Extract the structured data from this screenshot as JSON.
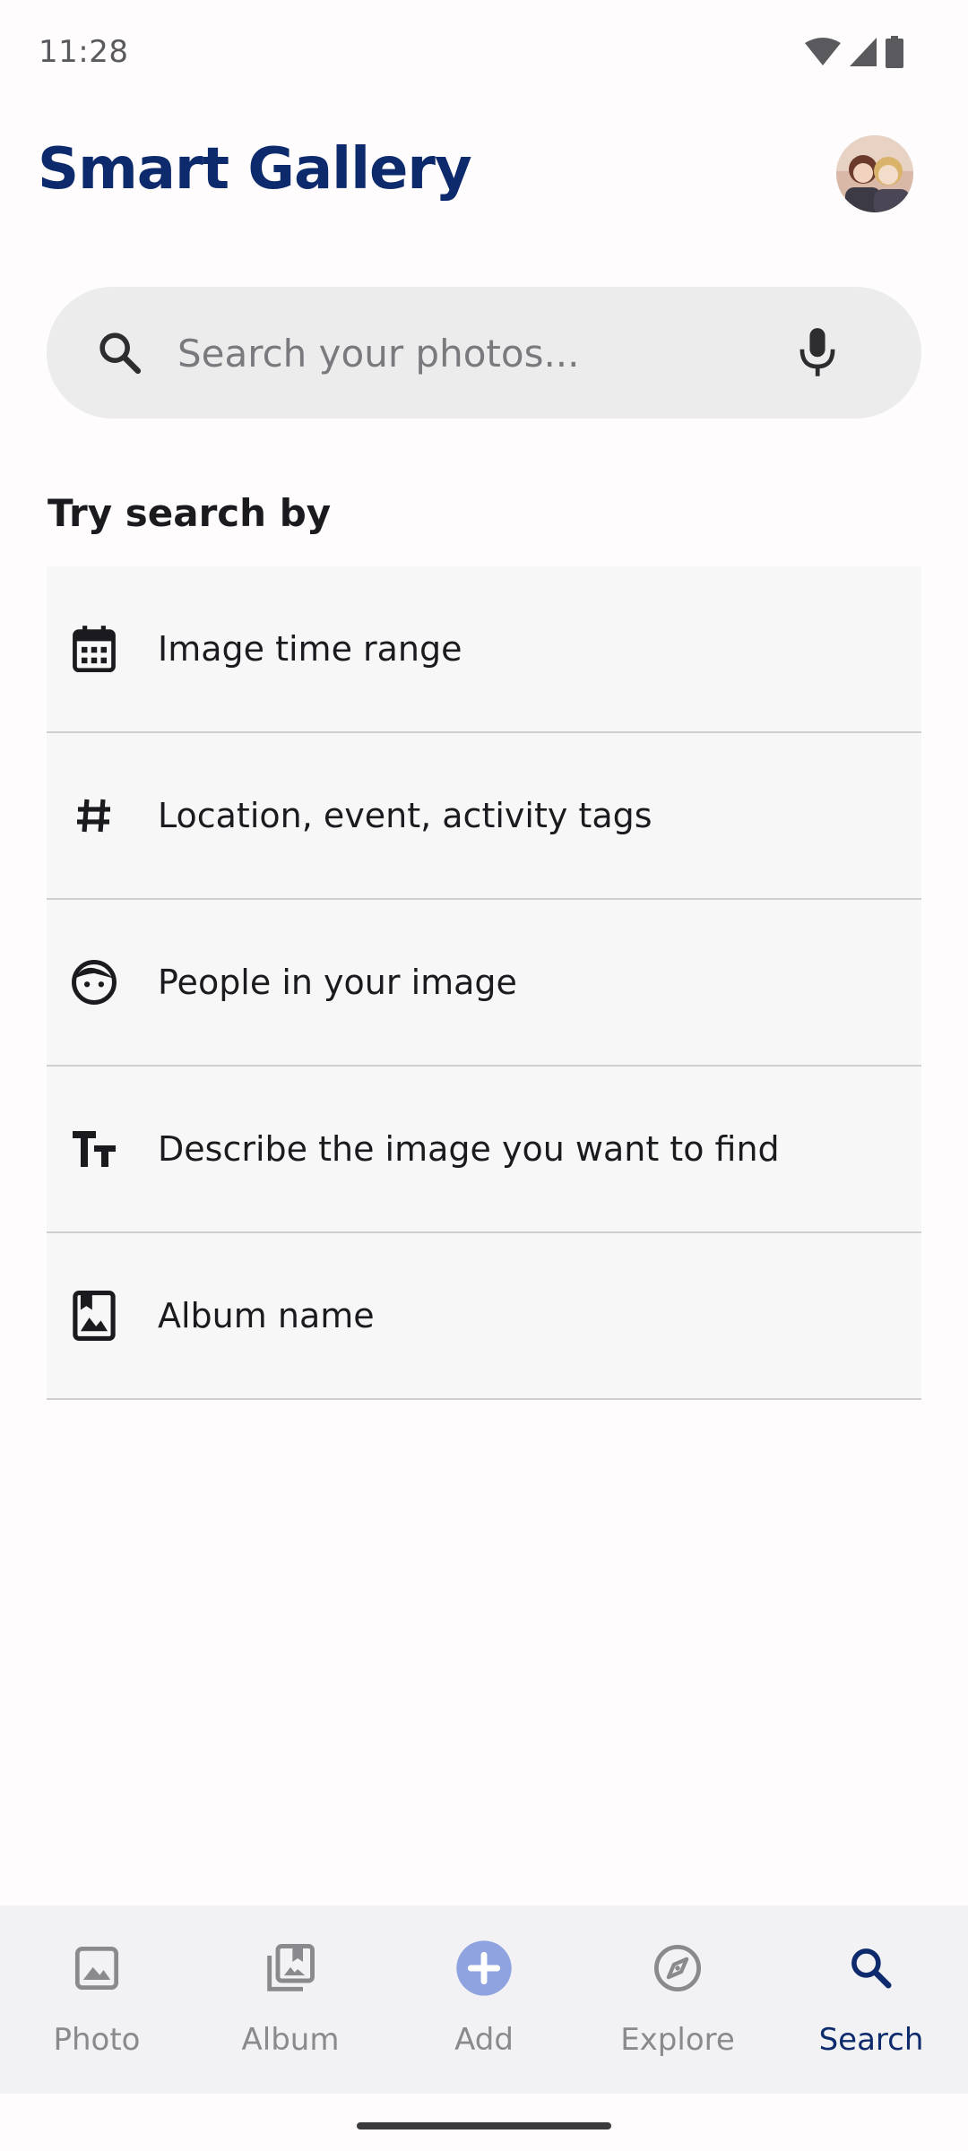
{
  "status_bar": {
    "time": "11:28",
    "icons": [
      "wifi-icon",
      "cellular-signal-icon",
      "battery-icon"
    ]
  },
  "header": {
    "title": "Smart Gallery",
    "avatar": "profile-avatar"
  },
  "search": {
    "placeholder": "Search your photos...",
    "value": "",
    "left_icon": "search-icon",
    "right_icon": "microphone-icon"
  },
  "suggestions": {
    "title": "Try search by",
    "items": [
      {
        "label": "Image time range",
        "icon": "calendar-icon"
      },
      {
        "label": "Location, event, activity tags",
        "icon": "hashtag-icon"
      },
      {
        "label": "People in your image",
        "icon": "face-icon"
      },
      {
        "label": "Describe the image you want to find",
        "icon": "text-fields-icon"
      },
      {
        "label": "Album name",
        "icon": "photo-album-icon"
      }
    ]
  },
  "bottom_nav": {
    "items": [
      {
        "label": "Photo",
        "icon": "image-icon",
        "active": false
      },
      {
        "label": "Album",
        "icon": "library-icon",
        "active": false
      },
      {
        "label": "Add",
        "icon": "add-circle-icon",
        "active": false
      },
      {
        "label": "Explore",
        "icon": "compass-icon",
        "active": false
      },
      {
        "label": "Search",
        "icon": "search-icon",
        "active": true
      }
    ]
  },
  "colors": {
    "brand": "#0d2a6c",
    "search_background": "#ececec",
    "add_button": "#8ea3df",
    "inactive_nav": "#8a8a8e"
  }
}
